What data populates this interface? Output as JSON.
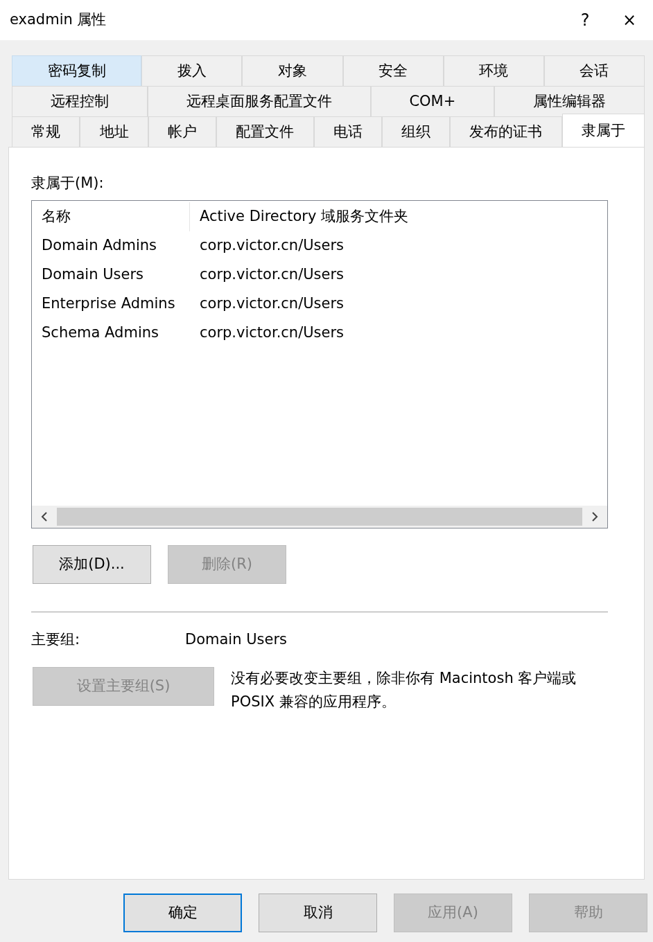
{
  "window": {
    "title": "exadmin 属性",
    "help": "?",
    "close": "×"
  },
  "tab_rows": [
    {
      "tabs": [
        {
          "label": "密码复制",
          "selected": false,
          "hot": true
        },
        {
          "label": "拨入",
          "selected": false,
          "hot": false
        },
        {
          "label": "对象",
          "selected": false,
          "hot": false
        },
        {
          "label": "安全",
          "selected": false,
          "hot": false
        },
        {
          "label": "环境",
          "selected": false,
          "hot": false
        },
        {
          "label": "会话",
          "selected": false,
          "hot": false
        }
      ]
    },
    {
      "tabs": [
        {
          "label": "远程控制",
          "selected": false,
          "hot": false
        },
        {
          "label": "远程桌面服务配置文件",
          "selected": false,
          "hot": false
        },
        {
          "label": "COM+",
          "selected": false,
          "hot": false
        },
        {
          "label": "属性编辑器",
          "selected": false,
          "hot": false
        }
      ]
    },
    {
      "tabs": [
        {
          "label": "常规",
          "selected": false,
          "hot": false
        },
        {
          "label": "地址",
          "selected": false,
          "hot": false
        },
        {
          "label": "帐户",
          "selected": false,
          "hot": false
        },
        {
          "label": "配置文件",
          "selected": false,
          "hot": false
        },
        {
          "label": "电话",
          "selected": false,
          "hot": false
        },
        {
          "label": "组织",
          "selected": false,
          "hot": false
        },
        {
          "label": "发布的证书",
          "selected": false,
          "hot": false
        },
        {
          "label": "隶属于",
          "selected": true,
          "hot": false
        }
      ]
    }
  ],
  "member_of": {
    "label": "隶属于(M):",
    "columns": [
      "名称",
      "Active Directory 域服务文件夹"
    ],
    "rows": [
      [
        "Domain Admins",
        "corp.victor.cn/Users"
      ],
      [
        "Domain Users",
        "corp.victor.cn/Users"
      ],
      [
        "Enterprise Admins",
        "corp.victor.cn/Users"
      ],
      [
        "Schema Admins",
        "corp.victor.cn/Users"
      ]
    ],
    "buttons": [
      {
        "label": "添加(D)...",
        "disabled": false
      },
      {
        "label": "删除(R)",
        "disabled": true
      }
    ]
  },
  "primary_group": {
    "label": "主要组:",
    "value": "Domain Users",
    "button": {
      "label": "设置主要组(S)",
      "disabled": true
    },
    "note": "没有必要改变主要组，除非你有 Macintosh 客户端或 POSIX 兼容的应用程序。"
  },
  "footer_buttons": [
    {
      "label": "确定",
      "disabled": false,
      "default": true
    },
    {
      "label": "取消",
      "disabled": false,
      "default": false
    },
    {
      "label": "应用(A)",
      "disabled": true,
      "default": false
    },
    {
      "label": "帮助",
      "disabled": true,
      "default": false
    }
  ]
}
